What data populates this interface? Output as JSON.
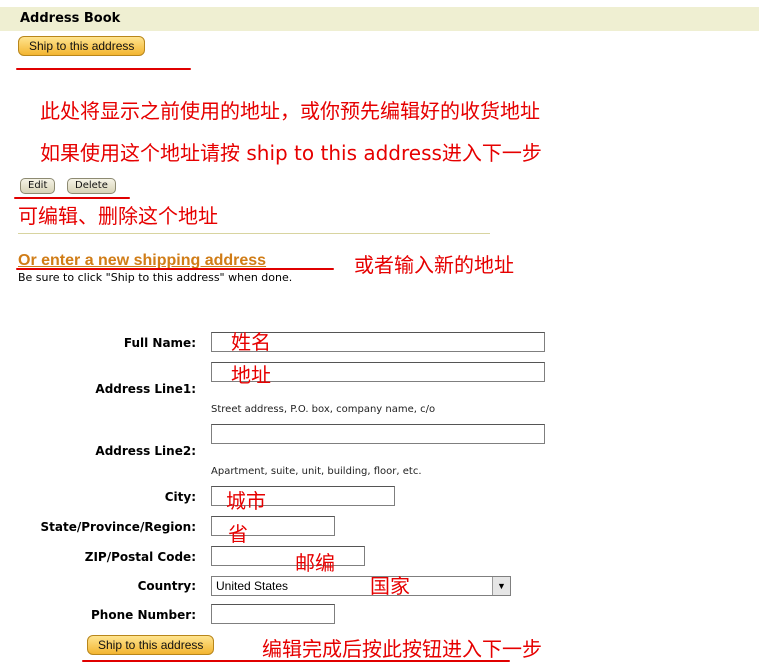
{
  "header": {
    "title": "Address Book"
  },
  "buttons": {
    "ship_top": "Ship to this address",
    "edit": "Edit",
    "delete": "Delete",
    "ship_bottom": "Ship to this address"
  },
  "annotations": {
    "saved_address_line1": "此处将显示之前使用的地址，或你预先编辑好的收货地址",
    "saved_address_line2": "如果使用这个地址请按 ship to this address进入下一步",
    "edit_delete": "可编辑、删除这个地址",
    "new_address": "或者输入新的地址",
    "full_name": "姓名",
    "address": "地址",
    "city": "城市",
    "state": "省",
    "zip": "邮编",
    "country": "国家",
    "submit": "编辑完成后按此按钮进入下一步"
  },
  "section": {
    "heading": "Or enter a new shipping address",
    "subtitle": "Be sure to click \"Ship to this address\" when done."
  },
  "form": {
    "full_name_label": "Full Name:",
    "address1_label": "Address Line1:",
    "address1_hint": "Street address, P.O. box, company name, c/o",
    "address2_label": "Address Line2:",
    "address2_hint": "Apartment, suite, unit, building, floor, etc.",
    "city_label": "City:",
    "state_label": "State/Province/Region:",
    "zip_label": "ZIP/Postal Code:",
    "country_label": "Country:",
    "country_value": "United States",
    "phone_label": "Phone Number:"
  },
  "colors": {
    "annotation": "#e60000",
    "heading": "#d07c16",
    "header_bg": "#efefd2"
  }
}
